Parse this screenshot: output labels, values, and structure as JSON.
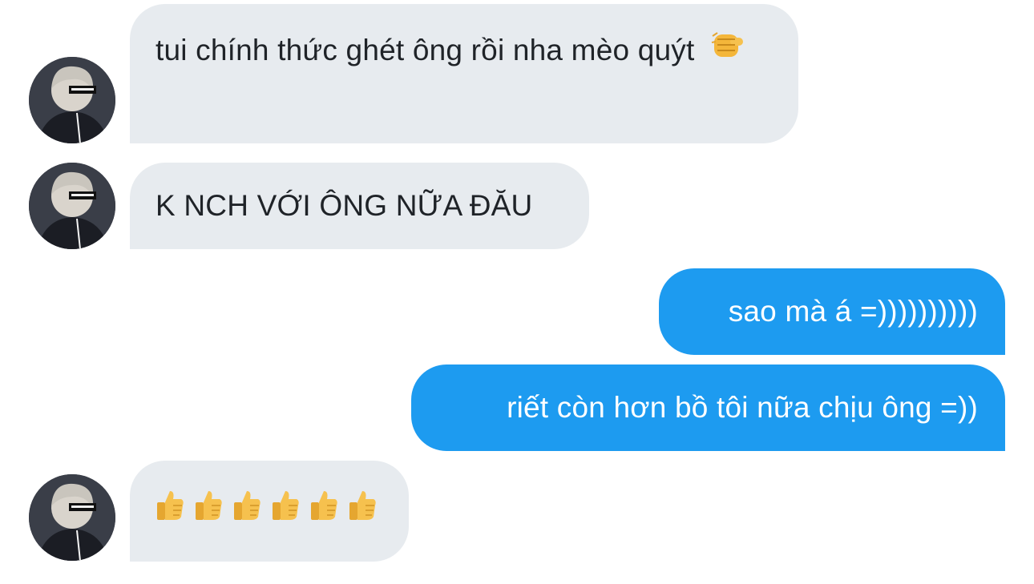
{
  "conversation": {
    "messages": [
      {
        "sender": "other",
        "text": "tui chính thức ghét ông rồi nha mèo quýt",
        "emoji": "punch-icon"
      },
      {
        "sender": "other",
        "text": "K NCH VỚI ÔNG NỮA ĐĂU"
      },
      {
        "sender": "me",
        "text": "sao mà á =))))))))))"
      },
      {
        "sender": "me",
        "text": "riết còn hơn bồ tôi nữa chịu ông =))"
      },
      {
        "sender": "other",
        "emoji": "thumbs-up-icon",
        "emoji_count": 6
      }
    ]
  },
  "colors": {
    "incoming_bubble": "#e7ebef",
    "outgoing_bubble": "#1d9bf0",
    "incoming_text": "#1f2328",
    "outgoing_text": "#ffffff"
  }
}
